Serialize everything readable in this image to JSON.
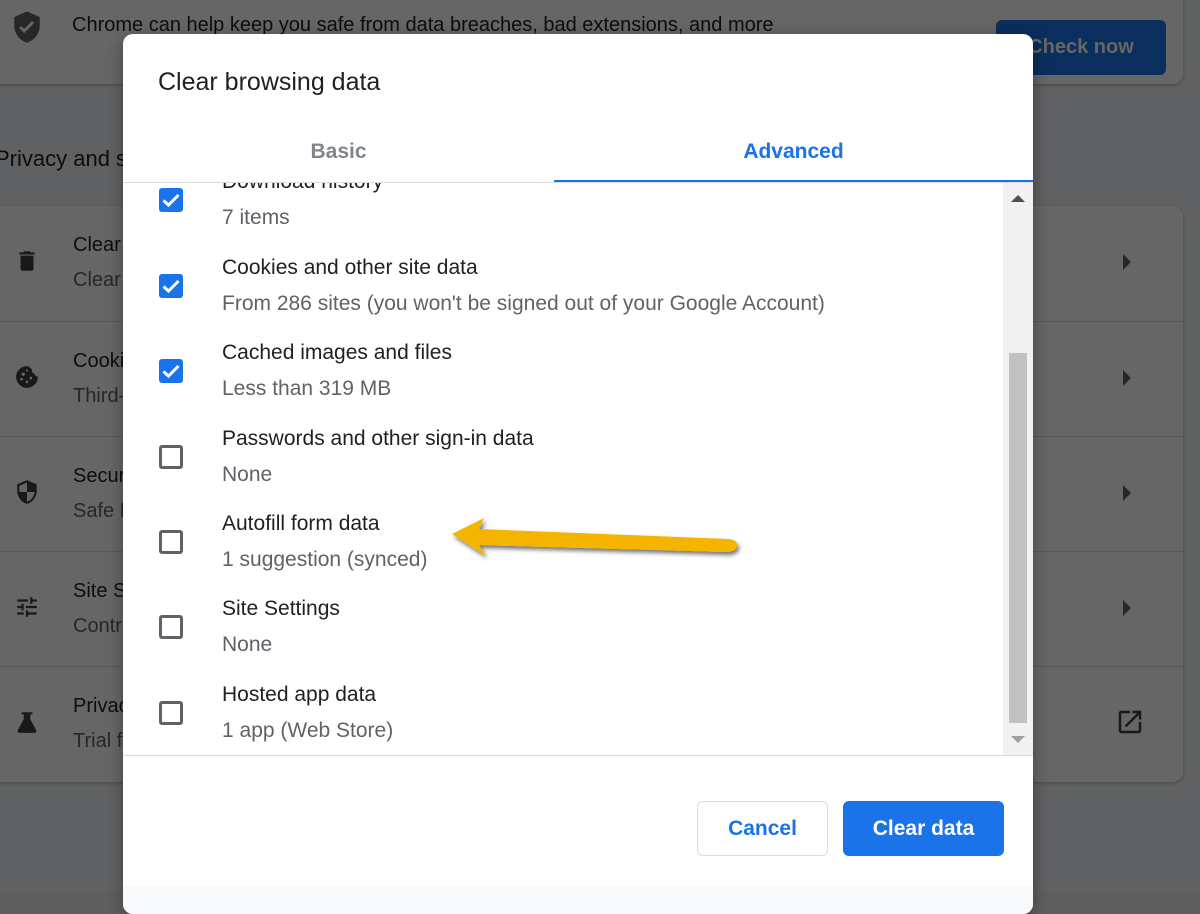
{
  "background": {
    "banner_text": "Chrome can help keep you safe from data breaches, bad extensions, and more",
    "check_now_label": "Check now",
    "section_title": "Privacy and security",
    "rows": [
      {
        "icon": "trash-icon",
        "title": "Clear browsing data",
        "subtitle": "Clear history, cookies, cache, and more",
        "trailing": "arrow-right-icon"
      },
      {
        "icon": "cookie-icon",
        "title": "Cookies and other site data",
        "subtitle": "Third-party cookies are blocked in Incognito mode",
        "trailing": "arrow-right-icon"
      },
      {
        "icon": "security-shield-icon",
        "title": "Security",
        "subtitle": "Safe Browsing (protection from dangerous sites) and other security settings",
        "trailing": "arrow-right-icon"
      },
      {
        "icon": "tune-sliders-icon",
        "title": "Site Settings",
        "subtitle": "Controls what information sites can use and show",
        "trailing": "arrow-right-icon"
      },
      {
        "icon": "flask-icon",
        "title": "Privacy Sandbox",
        "subtitle": "Trial features are on",
        "trailing": "open-external-icon"
      }
    ]
  },
  "dialog": {
    "title": "Clear browsing data",
    "tabs": [
      {
        "label": "Basic",
        "active": false
      },
      {
        "label": "Advanced",
        "active": true
      }
    ],
    "items": [
      {
        "label": "Download history",
        "detail": "7 items",
        "checked": true
      },
      {
        "label": "Cookies and other site data",
        "detail": "From 286 sites (you won't be signed out of your Google Account)",
        "checked": true
      },
      {
        "label": "Cached images and files",
        "detail": "Less than 319 MB",
        "checked": true
      },
      {
        "label": "Passwords and other sign-in data",
        "detail": "None",
        "checked": false
      },
      {
        "label": "Autofill form data",
        "detail": "1 suggestion (synced)",
        "checked": false
      },
      {
        "label": "Site Settings",
        "detail": "None",
        "checked": false
      },
      {
        "label": "Hosted app data",
        "detail": "1 app (Web Store)",
        "checked": false
      }
    ],
    "cancel_label": "Cancel",
    "clear_label": "Clear data"
  },
  "annotation": {
    "type": "arrow",
    "color": "#f5b400",
    "points_to": "Autofill form data"
  },
  "colors": {
    "accent": "#1a73e8",
    "annotation": "#f5b400"
  }
}
